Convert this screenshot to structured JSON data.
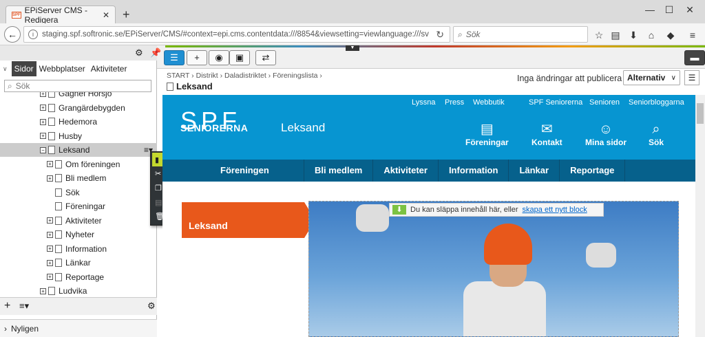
{
  "browser": {
    "tab_title": "EPiServer CMS - Redigera",
    "favicon_text": "SPF",
    "url": "staging.spf.softronic.se/EPiServer/CMS/#context=epi.cms.contentdata:///8854&viewsetting=viewlanguage:///sv",
    "search_placeholder": "Sök"
  },
  "left_panel": {
    "tabs": [
      "Sidor",
      "Webbplatser",
      "Aktiviteter"
    ],
    "search_placeholder": "Sök",
    "tree": [
      {
        "label": "Gagnef Hörsjö",
        "level": 1,
        "expand": true
      },
      {
        "label": "Grangärdebygden",
        "level": 1,
        "expand": true
      },
      {
        "label": "Hedemora",
        "level": 1,
        "expand": true
      },
      {
        "label": "Husby",
        "level": 1,
        "expand": true
      },
      {
        "label": "Leksand",
        "level": 1,
        "expand": "open"
      },
      {
        "label": "Om föreningen",
        "level": 2,
        "expand": true
      },
      {
        "label": "Bli medlem",
        "level": 2,
        "expand": true
      },
      {
        "label": "Sök",
        "level": 2,
        "expand": false
      },
      {
        "label": "Föreningar",
        "level": 2,
        "expand": false
      },
      {
        "label": "Aktiviteter",
        "level": 2,
        "expand": true
      },
      {
        "label": "Nyheter",
        "level": 2,
        "expand": true
      },
      {
        "label": "Information",
        "level": 2,
        "expand": true
      },
      {
        "label": "Länkar",
        "level": 2,
        "expand": true
      },
      {
        "label": "Reportage",
        "level": 2,
        "expand": true
      },
      {
        "label": "Ludvika",
        "level": 1,
        "expand": true
      }
    ],
    "recent_label": "Nyligen"
  },
  "context_menu": {
    "items": [
      {
        "label": "Ny sida",
        "state": "highlighted",
        "icon": "page-icon"
      },
      {
        "label": "Klipp ut",
        "state": "normal",
        "icon": "scissors-icon"
      },
      {
        "label": "Kopiera",
        "state": "normal",
        "icon": "copy-icon"
      },
      {
        "label": "Klistra in",
        "state": "disabled",
        "icon": "paste-icon"
      },
      {
        "label": "Flytta till papperskorgen",
        "state": "normal",
        "icon": "trash-icon"
      }
    ]
  },
  "editor": {
    "breadcrumb": [
      "START",
      "Distrikt",
      "Daladistriktet",
      "Föreningslista"
    ],
    "page_title": "Leksand",
    "status": "Inga ändringar att publicera",
    "options_button": "Alternativ"
  },
  "site": {
    "logo_line1": "SPF",
    "logo_line2": "SENIORERNA",
    "site_name": "Leksand",
    "top_links": [
      "Lyssna",
      "Press",
      "Webbutik",
      "SPF Seniorerna",
      "Senioren",
      "Seniorbloggarna"
    ],
    "header_icons": [
      {
        "label": "Föreningar",
        "icon": "list-icon"
      },
      {
        "label": "Kontakt",
        "icon": "mail-icon"
      },
      {
        "label": "Mina sidor",
        "icon": "user-icon"
      },
      {
        "label": "Sök",
        "icon": "search-icon"
      }
    ],
    "nav": [
      "Föreningen",
      "Bli medlem",
      "Aktiviteter",
      "Information",
      "Länkar",
      "Reportage"
    ],
    "banner_text": "Leksand",
    "drop_text": "Du kan släppa innehåll här, eller",
    "drop_link": "skapa ett nytt block"
  },
  "colors": {
    "site_blue": "#0795d1",
    "nav_blue": "#06618c",
    "banner_orange": "#e8581b",
    "menu_highlight": "#c4d82e"
  }
}
